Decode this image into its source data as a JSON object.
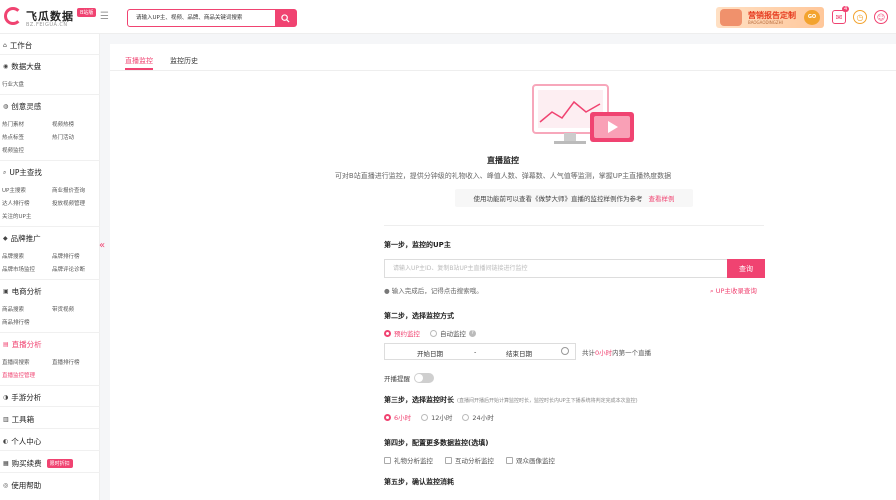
{
  "header": {
    "logo_text": "飞瓜数据",
    "logo_badge": "B站版",
    "logo_sub": "BZ.FEIGUA.CN",
    "search_placeholder": "请输入UP主、视频、品牌、商品关键词搜索",
    "banner_main": "营销报告定制",
    "banner_sub": "BAOGAODINGZHI",
    "banner_btn": "GO",
    "msg_count": "4"
  },
  "sidebar": {
    "workspace": "工作台",
    "sections": [
      {
        "title": "数据大盘",
        "items": [
          "行业大盘"
        ]
      },
      {
        "title": "创意灵感",
        "items": [
          "热门素材",
          "视频热榜",
          "热点标签",
          "热门活动",
          "视频监控"
        ]
      },
      {
        "title": "UP主查找",
        "items": [
          "UP主搜索",
          "商业报价查询",
          "达人排行榜",
          "投放视频管理",
          "关注的UP主"
        ]
      },
      {
        "title": "品牌推广",
        "items": [
          "品牌搜索",
          "品牌排行榜",
          "品牌市场监控",
          "品牌评论诊断"
        ]
      },
      {
        "title": "电商分析",
        "items": [
          "商品搜索",
          "带货视频",
          "商品排行榜"
        ]
      },
      {
        "title": "直播分析",
        "items": [
          "直播间搜索",
          "直播排行榜",
          "直播监控管理"
        ]
      },
      {
        "title": "手游分析",
        "items": []
      },
      {
        "title": "工具箱",
        "items": []
      },
      {
        "title": "个人中心",
        "items": []
      },
      {
        "title": "购买续费",
        "badge": "限时折扣",
        "items": []
      },
      {
        "title": "使用帮助",
        "items": []
      }
    ]
  },
  "tabs": [
    "直播监控",
    "监控历史"
  ],
  "hero": {
    "title": "直播监控",
    "desc": "可对B站直播进行监控，提供分钟级的礼物收入、峰值人数、弹幕数、人气值等监测，掌握UP主直播热度数据",
    "tip": "使用功能前可以查看《做梦大师》直播的监控样例作为参考",
    "tip_link": "查看样例"
  },
  "step1": {
    "title": "第一步，监控的UP主",
    "placeholder": "请输入UP主ID、复制B站UP主直播间链接进行监控",
    "button": "查询",
    "hint": "输入完成后，记得点击搜索哦。",
    "hint_right": "UP主收录查询"
  },
  "step2": {
    "title": "第二步，选择监控方式",
    "options": [
      "预约监控",
      "自动监控"
    ],
    "date_start": "开始日期",
    "date_sep": "-",
    "date_end": "结束日期",
    "note_prefix": "共计",
    "note_hl": "0小时",
    "note_suffix": "内第一个直播",
    "toggle_label": "开播提醒"
  },
  "step3": {
    "title": "第三步，选择监控时长",
    "note": "(直播间开播后开始计算监控时长，监控时长内UP主下播系统将判定完成本次监控)",
    "options": [
      "6小时",
      "12小时",
      "24小时"
    ]
  },
  "step4": {
    "title": "第四步，配置更多数据监控(选填)",
    "options": [
      "礼物分析监控",
      "互动分析监控",
      "观众画像监控"
    ]
  },
  "step5": {
    "title": "第五步，确认监控消耗"
  },
  "colors": {
    "accent": "#f04371",
    "bg": "#f5f6f8"
  }
}
